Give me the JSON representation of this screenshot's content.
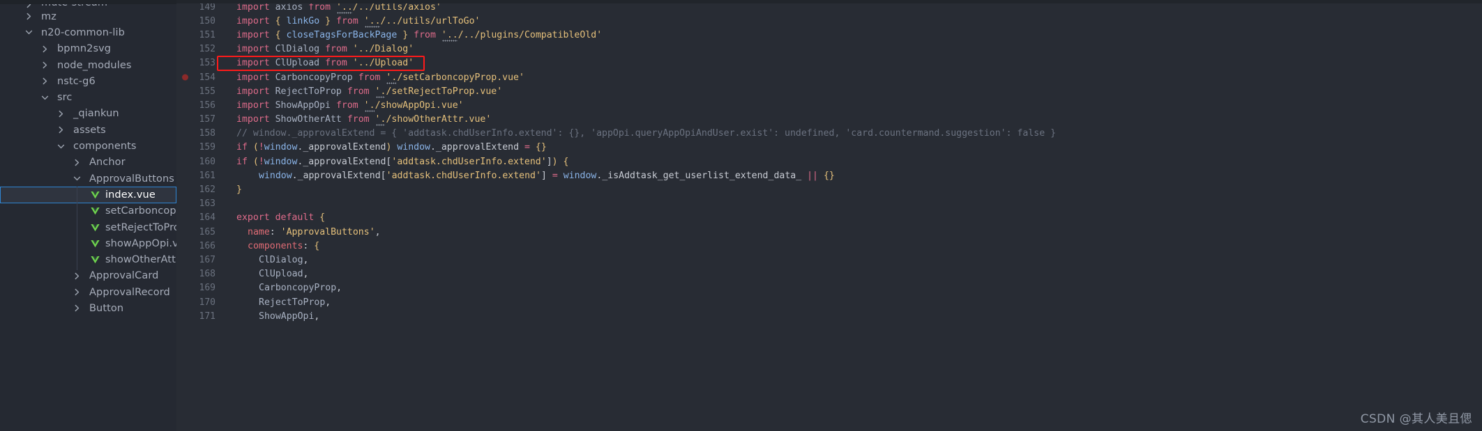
{
  "app": {
    "theme_bg": "#282c34",
    "sidebar_bg": "#252932",
    "accent_selection": "#2f86d4",
    "annotation_color": "#ff1a1a",
    "watermark": "CSDN @其人美且偲"
  },
  "sidebar": {
    "items": [
      {
        "label": "mute-stream",
        "indent": 1,
        "icon": "chevron-right-icon",
        "kind": "folder",
        "selected": false,
        "clipped": true
      },
      {
        "label": "mz",
        "indent": 1,
        "icon": "chevron-right-icon",
        "kind": "folder",
        "selected": false
      },
      {
        "label": "n20-common-lib",
        "indent": 1,
        "icon": "chevron-down-icon",
        "kind": "folder",
        "selected": false
      },
      {
        "label": "bpmn2svg",
        "indent": 2,
        "icon": "chevron-right-icon",
        "kind": "folder",
        "selected": false
      },
      {
        "label": "node_modules",
        "indent": 2,
        "icon": "chevron-right-icon",
        "kind": "folder",
        "selected": false
      },
      {
        "label": "nstc-g6",
        "indent": 2,
        "icon": "chevron-right-icon",
        "kind": "folder",
        "selected": false
      },
      {
        "label": "src",
        "indent": 2,
        "icon": "chevron-down-icon",
        "kind": "folder",
        "selected": false
      },
      {
        "label": "_qiankun",
        "indent": 3,
        "icon": "chevron-right-icon",
        "kind": "folder",
        "selected": false
      },
      {
        "label": "assets",
        "indent": 3,
        "icon": "chevron-right-icon",
        "kind": "folder",
        "selected": false
      },
      {
        "label": "components",
        "indent": 3,
        "icon": "chevron-down-icon",
        "kind": "folder",
        "selected": false
      },
      {
        "label": "Anchor",
        "indent": 4,
        "icon": "chevron-right-icon",
        "kind": "folder",
        "selected": false
      },
      {
        "label": "ApprovalButtons",
        "indent": 4,
        "icon": "chevron-down-icon",
        "kind": "folder",
        "selected": false
      },
      {
        "label": "index.vue",
        "indent": 5,
        "icon": "vue-file-icon",
        "kind": "file",
        "selected": true
      },
      {
        "label": "setCarboncopyProp.vue",
        "indent": 5,
        "icon": "vue-file-icon",
        "kind": "file",
        "selected": false
      },
      {
        "label": "setRejectToProp.vue",
        "indent": 5,
        "icon": "vue-file-icon",
        "kind": "file",
        "selected": false
      },
      {
        "label": "showAppOpi.vue",
        "indent": 5,
        "icon": "vue-file-icon",
        "kind": "file",
        "selected": false
      },
      {
        "label": "showOtherAttr.vue",
        "indent": 5,
        "icon": "vue-file-icon",
        "kind": "file",
        "selected": false
      },
      {
        "label": "ApprovalCard",
        "indent": 4,
        "icon": "chevron-right-icon",
        "kind": "folder",
        "selected": false
      },
      {
        "label": "ApprovalRecord",
        "indent": 4,
        "icon": "chevron-right-icon",
        "kind": "folder",
        "selected": false
      },
      {
        "label": "Button",
        "indent": 4,
        "icon": "chevron-right-icon",
        "kind": "folder",
        "selected": false
      }
    ]
  },
  "editor": {
    "first_line_number": 149,
    "highlighted_line": 153,
    "breakpoint_line": 154,
    "lines": [
      {
        "n": 149,
        "tokens": [
          {
            "t": "import",
            "c": "kw"
          },
          {
            "t": " ",
            "c": "white"
          },
          {
            "t": "axios",
            "c": "id"
          },
          {
            "t": " ",
            "c": "white"
          },
          {
            "t": "from",
            "c": "kw"
          },
          {
            "t": " ",
            "c": "white"
          },
          {
            "t": "'..",
            "c": "str",
            "dots": true
          },
          {
            "t": "/../utils/axios'",
            "c": "str"
          }
        ]
      },
      {
        "n": 150,
        "tokens": [
          {
            "t": "import",
            "c": "kw"
          },
          {
            "t": " ",
            "c": "white"
          },
          {
            "t": "{",
            "c": "brace"
          },
          {
            "t": " ",
            "c": "white"
          },
          {
            "t": "linkGo",
            "c": "var"
          },
          {
            "t": " ",
            "c": "white"
          },
          {
            "t": "}",
            "c": "brace"
          },
          {
            "t": " ",
            "c": "white"
          },
          {
            "t": "from",
            "c": "kw"
          },
          {
            "t": " ",
            "c": "white"
          },
          {
            "t": "'..",
            "c": "str",
            "dots": true
          },
          {
            "t": "/../utils/urlToGo'",
            "c": "str"
          }
        ]
      },
      {
        "n": 151,
        "tokens": [
          {
            "t": "import",
            "c": "kw"
          },
          {
            "t": " ",
            "c": "white"
          },
          {
            "t": "{",
            "c": "brace"
          },
          {
            "t": " ",
            "c": "white"
          },
          {
            "t": "closeTagsForBackPage",
            "c": "var"
          },
          {
            "t": " ",
            "c": "white"
          },
          {
            "t": "}",
            "c": "brace"
          },
          {
            "t": " ",
            "c": "white"
          },
          {
            "t": "from",
            "c": "kw"
          },
          {
            "t": " ",
            "c": "white"
          },
          {
            "t": "'..",
            "c": "str",
            "dots": true
          },
          {
            "t": "/../plugins/CompatibleOld'",
            "c": "str"
          }
        ]
      },
      {
        "n": 152,
        "tokens": [
          {
            "t": "import",
            "c": "kw"
          },
          {
            "t": " ",
            "c": "white"
          },
          {
            "t": "ClDialog",
            "c": "id"
          },
          {
            "t": " ",
            "c": "white"
          },
          {
            "t": "from",
            "c": "kw"
          },
          {
            "t": " ",
            "c": "white"
          },
          {
            "t": "'../Dialog'",
            "c": "str"
          }
        ]
      },
      {
        "n": 153,
        "tokens": [
          {
            "t": "import",
            "c": "kw"
          },
          {
            "t": " ",
            "c": "white"
          },
          {
            "t": "ClUpload",
            "c": "id"
          },
          {
            "t": " ",
            "c": "white"
          },
          {
            "t": "from",
            "c": "kw"
          },
          {
            "t": " ",
            "c": "white"
          },
          {
            "t": "'../Upload'",
            "c": "str"
          }
        ]
      },
      {
        "n": 154,
        "tokens": [
          {
            "t": "import",
            "c": "kw"
          },
          {
            "t": " ",
            "c": "white"
          },
          {
            "t": "CarboncopyProp",
            "c": "id"
          },
          {
            "t": " ",
            "c": "white"
          },
          {
            "t": "from",
            "c": "kw"
          },
          {
            "t": " ",
            "c": "white"
          },
          {
            "t": "'.",
            "c": "str",
            "dots": true
          },
          {
            "t": "/setCarboncopyProp.vue'",
            "c": "str"
          }
        ]
      },
      {
        "n": 155,
        "tokens": [
          {
            "t": "import",
            "c": "kw"
          },
          {
            "t": " ",
            "c": "white"
          },
          {
            "t": "RejectToProp",
            "c": "id"
          },
          {
            "t": " ",
            "c": "white"
          },
          {
            "t": "from",
            "c": "kw"
          },
          {
            "t": " ",
            "c": "white"
          },
          {
            "t": "'.",
            "c": "str",
            "dots": true
          },
          {
            "t": "/setRejectToProp.vue'",
            "c": "str"
          }
        ]
      },
      {
        "n": 156,
        "tokens": [
          {
            "t": "import",
            "c": "kw"
          },
          {
            "t": " ",
            "c": "white"
          },
          {
            "t": "ShowAppOpi",
            "c": "id"
          },
          {
            "t": " ",
            "c": "white"
          },
          {
            "t": "from",
            "c": "kw"
          },
          {
            "t": " ",
            "c": "white"
          },
          {
            "t": "'.",
            "c": "str",
            "dots": true
          },
          {
            "t": "/showAppOpi.vue'",
            "c": "str"
          }
        ]
      },
      {
        "n": 157,
        "tokens": [
          {
            "t": "import",
            "c": "kw"
          },
          {
            "t": " ",
            "c": "white"
          },
          {
            "t": "ShowOtherAtt",
            "c": "id"
          },
          {
            "t": " ",
            "c": "white"
          },
          {
            "t": "from",
            "c": "kw"
          },
          {
            "t": " ",
            "c": "white"
          },
          {
            "t": "'.",
            "c": "str",
            "dots": true
          },
          {
            "t": "/showOtherAttr.vue'",
            "c": "str"
          }
        ]
      },
      {
        "n": 158,
        "tokens": [
          {
            "t": "// window._approvalExtend = { 'addtask.chdUserInfo.extend': {}, 'appOpi.queryAppOpiAndUser.exist': undefined, 'card.countermand.suggestion': false }",
            "c": "comment"
          }
        ]
      },
      {
        "n": 159,
        "tokens": [
          {
            "t": "if",
            "c": "kw"
          },
          {
            "t": " ",
            "c": "white"
          },
          {
            "t": "(",
            "c": "brace"
          },
          {
            "t": "!",
            "c": "kw"
          },
          {
            "t": "window",
            "c": "var"
          },
          {
            "t": "._approvalExtend",
            "c": "white"
          },
          {
            "t": ")",
            "c": "brace"
          },
          {
            "t": " ",
            "c": "white"
          },
          {
            "t": "window",
            "c": "var"
          },
          {
            "t": "._approvalExtend ",
            "c": "white"
          },
          {
            "t": "=",
            "c": "kw"
          },
          {
            "t": " ",
            "c": "white"
          },
          {
            "t": "{}",
            "c": "brace"
          }
        ]
      },
      {
        "n": 160,
        "tokens": [
          {
            "t": "if",
            "c": "kw"
          },
          {
            "t": " ",
            "c": "white"
          },
          {
            "t": "(",
            "c": "brace"
          },
          {
            "t": "!",
            "c": "kw"
          },
          {
            "t": "window",
            "c": "var"
          },
          {
            "t": "._approvalExtend[",
            "c": "white"
          },
          {
            "t": "'addtask.chdUserInfo.extend'",
            "c": "str"
          },
          {
            "t": "]",
            "c": "white"
          },
          {
            "t": ")",
            "c": "brace"
          },
          {
            "t": " ",
            "c": "white"
          },
          {
            "t": "{",
            "c": "brace"
          }
        ]
      },
      {
        "n": 161,
        "indent": 2,
        "tokens": [
          {
            "t": "window",
            "c": "var"
          },
          {
            "t": "._approvalExtend[",
            "c": "white"
          },
          {
            "t": "'addtask.chdUserInfo.extend'",
            "c": "str"
          },
          {
            "t": "] ",
            "c": "white"
          },
          {
            "t": "=",
            "c": "kw"
          },
          {
            "t": " ",
            "c": "white"
          },
          {
            "t": "window",
            "c": "var"
          },
          {
            "t": "._isAddtask_get_userlist_extend_data_",
            "c": "white"
          },
          {
            "t": " ",
            "c": "white"
          },
          {
            "t": "||",
            "c": "kw"
          },
          {
            "t": " ",
            "c": "white"
          },
          {
            "t": "{}",
            "c": "brace"
          }
        ]
      },
      {
        "n": 162,
        "tokens": [
          {
            "t": "}",
            "c": "brace"
          }
        ]
      },
      {
        "n": 163,
        "tokens": []
      },
      {
        "n": 164,
        "tokens": [
          {
            "t": "export",
            "c": "kw"
          },
          {
            "t": " ",
            "c": "white"
          },
          {
            "t": "default",
            "c": "kw"
          },
          {
            "t": " ",
            "c": "white"
          },
          {
            "t": "{",
            "c": "brace"
          }
        ]
      },
      {
        "n": 165,
        "indent": 1,
        "tokens": [
          {
            "t": "name",
            "c": "red"
          },
          {
            "t": ": ",
            "c": "white"
          },
          {
            "t": "'ApprovalButtons'",
            "c": "str"
          },
          {
            "t": ",",
            "c": "white"
          }
        ]
      },
      {
        "n": 166,
        "indent": 1,
        "tokens": [
          {
            "t": "components",
            "c": "red"
          },
          {
            "t": ": ",
            "c": "white"
          },
          {
            "t": "{",
            "c": "brace"
          }
        ]
      },
      {
        "n": 167,
        "indent": 2,
        "tokens": [
          {
            "t": "ClDialog",
            "c": "id"
          },
          {
            "t": ",",
            "c": "white"
          }
        ]
      },
      {
        "n": 168,
        "indent": 2,
        "tokens": [
          {
            "t": "ClUpload",
            "c": "id"
          },
          {
            "t": ",",
            "c": "white"
          }
        ]
      },
      {
        "n": 169,
        "indent": 2,
        "tokens": [
          {
            "t": "CarboncopyProp",
            "c": "id"
          },
          {
            "t": ",",
            "c": "white"
          }
        ]
      },
      {
        "n": 170,
        "indent": 2,
        "tokens": [
          {
            "t": "RejectToProp",
            "c": "id"
          },
          {
            "t": ",",
            "c": "white"
          }
        ]
      },
      {
        "n": 171,
        "indent": 2,
        "tokens": [
          {
            "t": "ShowAppOpi",
            "c": "id"
          },
          {
            "t": ",",
            "c": "white"
          }
        ]
      }
    ]
  }
}
